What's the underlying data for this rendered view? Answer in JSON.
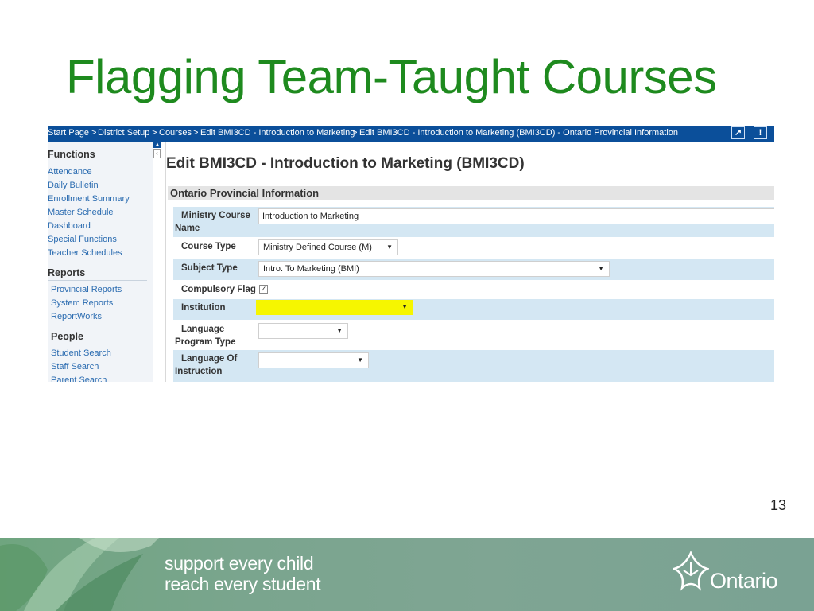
{
  "slide": {
    "title": "Flagging Team-Taught Courses",
    "page_number": "13"
  },
  "breadcrumb": {
    "items": [
      "Start Page",
      "District Setup",
      "Courses",
      "Edit BMI3CD - Introduction to Marketing",
      "Edit BMI3CD - Introduction to Marketing (BMI3CD) - Ontario Provincial Information"
    ],
    "separator": ">",
    "icons": [
      "popout-icon",
      "alert-icon"
    ]
  },
  "sidebar": {
    "sections": [
      {
        "heading": "Functions",
        "items": [
          "Attendance",
          "Daily Bulletin",
          "Enrollment Summary",
          "Master Schedule",
          "Dashboard",
          "Special Functions",
          "Teacher Schedules"
        ]
      },
      {
        "heading": "Reports",
        "items": [
          "Provincial Reports",
          "System Reports",
          "ReportWorks"
        ]
      },
      {
        "heading": "People",
        "items": [
          "Student Search",
          "Staff Search",
          "Parent Search"
        ]
      }
    ]
  },
  "main": {
    "page_heading": "Edit BMI3CD - Introduction to Marketing (BMI3CD)",
    "section_heading": "Ontario Provincial Information",
    "fields": {
      "ministry_course_name": {
        "label_1": "Ministry Course",
        "label_2": "Name",
        "value": "Introduction to Marketing"
      },
      "course_type": {
        "label": "Course Type",
        "value": "Ministry Defined Course (M)"
      },
      "subject_type": {
        "label": "Subject Type",
        "value": "Intro. To Marketing (BMI)"
      },
      "compulsory_flag": {
        "label": "Compulsory Flag",
        "checked": true
      },
      "institution": {
        "label": "Institution",
        "value": "",
        "highlight_color": "#f6f600"
      },
      "language_program_type": {
        "label_1": "Language",
        "label_2": "Program Type",
        "value": ""
      },
      "language_of_instruction": {
        "label_1": "Language Of",
        "label_2": "Instruction",
        "value": ""
      }
    }
  },
  "footer": {
    "tagline_1": "support every child",
    "tagline_2": "reach every student",
    "brand": "Ontario"
  },
  "colors": {
    "title_green": "#1e8a1e",
    "breadcrumb_bar": "#0b4f9a",
    "row_blue": "#d4e7f3",
    "footer_green": "#7aa58e"
  }
}
